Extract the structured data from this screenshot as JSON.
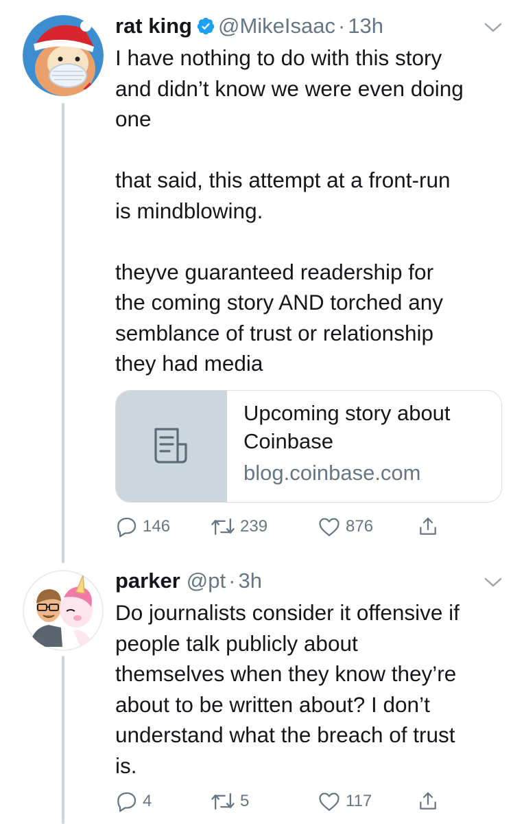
{
  "tweets": [
    {
      "display_name": "rat king",
      "handle": "@MikeIsaac",
      "separator": "·",
      "time": "13h",
      "verified": true,
      "avatar_icon": "santa-hamster-avatar-icon",
      "text": "I have nothing to do with this story\nand didn’t know we were even doing\none\n\nthat said, this attempt at a front-run\nis mindblowing.\n\ntheyve guaranteed readership for\nthe coming story AND torched any\nsemblance of trust or relationship\nthey had media",
      "card": {
        "title": "Upcoming story about Coinbase",
        "domain": "blog.coinbase.com",
        "thumb_icon": "document-icon"
      },
      "counts": {
        "replies": "146",
        "retweets": "239",
        "likes": "876"
      }
    },
    {
      "display_name": "parker",
      "handle": "@pt",
      "separator": "·",
      "time": "3h",
      "verified": false,
      "avatar_icon": "man-with-unicorn-avatar-icon",
      "text": "Do journalists consider it offensive if\npeople talk publicly about\nthemselves when they know they’re\nabout to be written about? I don’t\nunderstand what the breach of trust\nis.",
      "counts": {
        "replies": "4",
        "retweets": "5",
        "likes": "117"
      }
    }
  ],
  "colors": {
    "text": "#14171a",
    "secondary": "#657786",
    "verified_blue": "#1da1f2",
    "thread_line": "#ccd6dd",
    "card_thumb": "#ccd6dd"
  }
}
